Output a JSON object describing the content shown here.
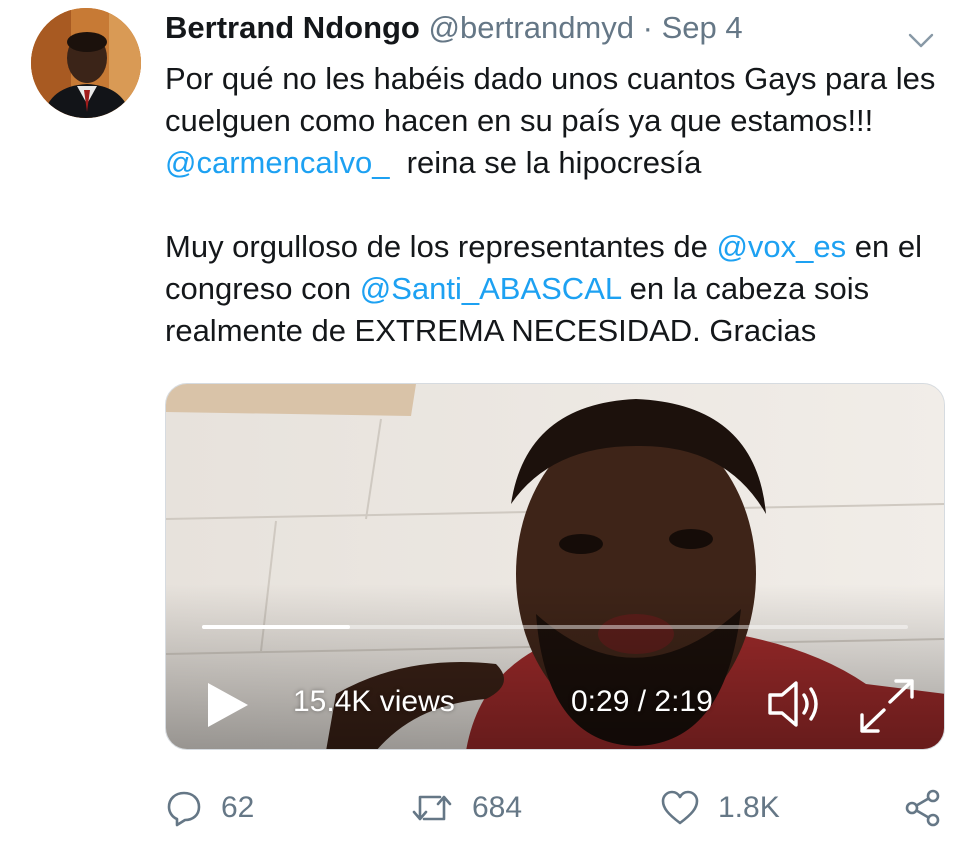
{
  "tweet": {
    "author_name": "Bertrand Ndongo",
    "author_handle": "@bertrandmyd",
    "separator": "·",
    "date": "Sep 4",
    "text": {
      "p1_part1": "Por qué no les habéis dado unos cuantos Gays para les cuelguen como hacen en su país ya que estamos!!! ",
      "p1_mention": "@carmencalvo_",
      "p1_part2": "  reina se la hipocresía",
      "p2_part1": "Muy orgulloso de los representantes de ",
      "p2_mention1": "@vox_es",
      "p2_part2": " en el congreso con ",
      "p2_mention2": "@Santi_ABASCAL",
      "p2_part3": " en la cabeza sois realmente de EXTREMA NECESIDAD. Gracias"
    }
  },
  "video": {
    "views": "15.4K views",
    "time": "0:29 / 2:19",
    "progress": 0.21
  },
  "actions": {
    "replies": "62",
    "retweets": "684",
    "likes": "1.8K"
  },
  "icons": {
    "reply": "reply-icon",
    "retweet": "retweet-icon",
    "like": "heart-icon",
    "share": "share-icon",
    "play": "play-icon",
    "sound": "speaker-icon",
    "expand": "expand-icon",
    "menu": "chevron-down-icon"
  },
  "colors": {
    "link": "#1da1f2",
    "muted": "#657786",
    "text": "#14171a"
  }
}
